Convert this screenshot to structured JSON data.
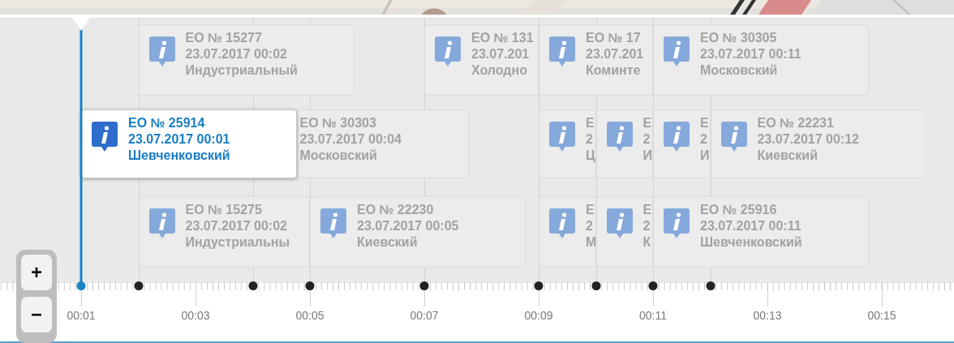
{
  "zoom": {
    "in": "+",
    "out": "−"
  },
  "axis_labels": [
    "00:01",
    "00:03",
    "00:05",
    "00:07",
    "00:09",
    "00:11",
    "00:13",
    "00:15"
  ],
  "timeline": [
    {
      "kind": "event",
      "selected": true,
      "middle": {
        "number": "ЕО № 25914",
        "timestamp": "23.07.2017 00:01",
        "district": "Шевченковский"
      }
    },
    {
      "kind": "event",
      "selected": false,
      "top": {
        "number": "ЕО № 15277",
        "timestamp": "23.07.2017 00:02",
        "district": "Индустриальный"
      },
      "bottom": {
        "number": "ЕО № 15275",
        "timestamp": "23.07.2017 00:02",
        "district": "Индустриальны"
      }
    },
    {
      "kind": "empty"
    },
    {
      "kind": "event",
      "selected": false,
      "middle": {
        "number": "ЕО № 30303",
        "timestamp": "23.07.2017 00:04",
        "district": "Московский"
      }
    },
    {
      "kind": "event",
      "selected": false,
      "bottom": {
        "number": "ЕО № 22230",
        "timestamp": "23.07.2017 00:05",
        "district": "Киевский"
      }
    },
    {
      "kind": "empty"
    },
    {
      "kind": "event",
      "selected": false,
      "top": {
        "number": "ЕО № 131",
        "timestamp": "23.07.201",
        "district": "Холодно"
      }
    },
    {
      "kind": "empty"
    },
    {
      "kind": "event",
      "selected": false,
      "top": {
        "number": "ЕО № 17",
        "timestamp": "23.07.201",
        "district": "Коминте"
      },
      "middle": {
        "number": "Е",
        "timestamp": "2",
        "district": "Ц"
      },
      "bottom": {
        "number": "Е",
        "timestamp": "2",
        "district": "М"
      }
    },
    {
      "kind": "event",
      "selected": false,
      "middle": {
        "number": "Е",
        "timestamp": "2",
        "district": "И"
      },
      "bottom": {
        "number": "Е",
        "timestamp": "2",
        "district": "К"
      }
    },
    {
      "kind": "event",
      "selected": false,
      "top": {
        "number": "ЕО № 30305",
        "timestamp": "23.07.2017 00:11",
        "district": "Московский"
      },
      "middle": {
        "number": "Е",
        "timestamp": "2",
        "district": "И"
      },
      "bottom": {
        "number": "ЕО № 25916",
        "timestamp": "23.07.2017 00:11",
        "district": "Шевченковский"
      }
    },
    {
      "kind": "event",
      "selected": false,
      "middle": {
        "number": "ЕО № 22231",
        "timestamp": "23.07.2017 00:12",
        "district": "Киевский"
      }
    }
  ]
}
